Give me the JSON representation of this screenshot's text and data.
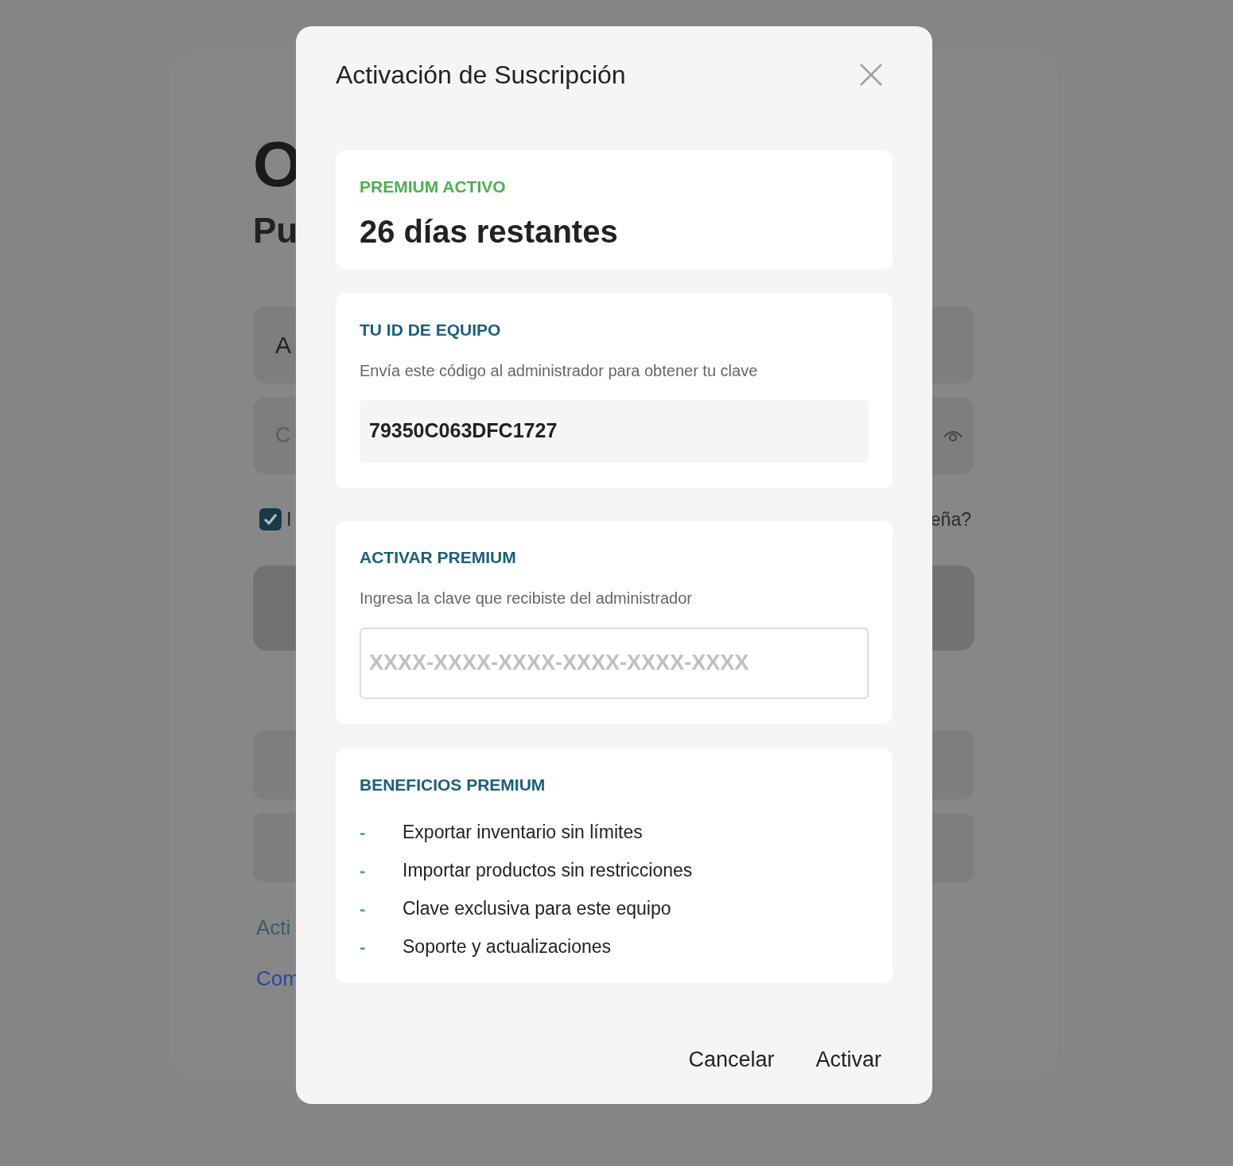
{
  "background_page": {
    "heading": "O",
    "subheading": "Pu",
    "fields": [
      {
        "kind": "text",
        "value": "A"
      },
      {
        "kind": "password",
        "placeholder": "C"
      }
    ],
    "remember": {
      "label": "I",
      "checked": true
    },
    "forgot_link": "eña?",
    "links": [
      {
        "text": "Acti",
        "color": "#3d5a6b"
      },
      {
        "text": "Com",
        "color": "#2a4a9a"
      }
    ]
  },
  "dialog": {
    "title": "Activación de Suscripción",
    "status": {
      "badge": "PREMIUM ACTIVO",
      "days": "26 días restantes"
    },
    "device_id": {
      "title": "TU ID DE EQUIPO",
      "description": "Envía este código al administrador para obtener tu clave",
      "value": "79350C063DFC1727"
    },
    "activate": {
      "title": "ACTIVAR PREMIUM",
      "description": "Ingresa la clave que recibiste del administrador",
      "placeholder": "XXXX-XXXX-XXXX-XXXX-XXXX-XXXX"
    },
    "benefits": {
      "title": "BENEFICIOS PREMIUM",
      "items": [
        {
          "bullet": "-",
          "text": "Exportar inventario sin límites"
        },
        {
          "bullet": "-",
          "text": "Importar productos sin restricciones"
        },
        {
          "bullet": "-",
          "text": "Clave exclusiva para este equipo"
        },
        {
          "bullet": "-",
          "text": "Soporte y actualizaciones"
        }
      ]
    },
    "buttons": [
      {
        "label": "Cancelar"
      },
      {
        "label": "Activar"
      }
    ]
  }
}
